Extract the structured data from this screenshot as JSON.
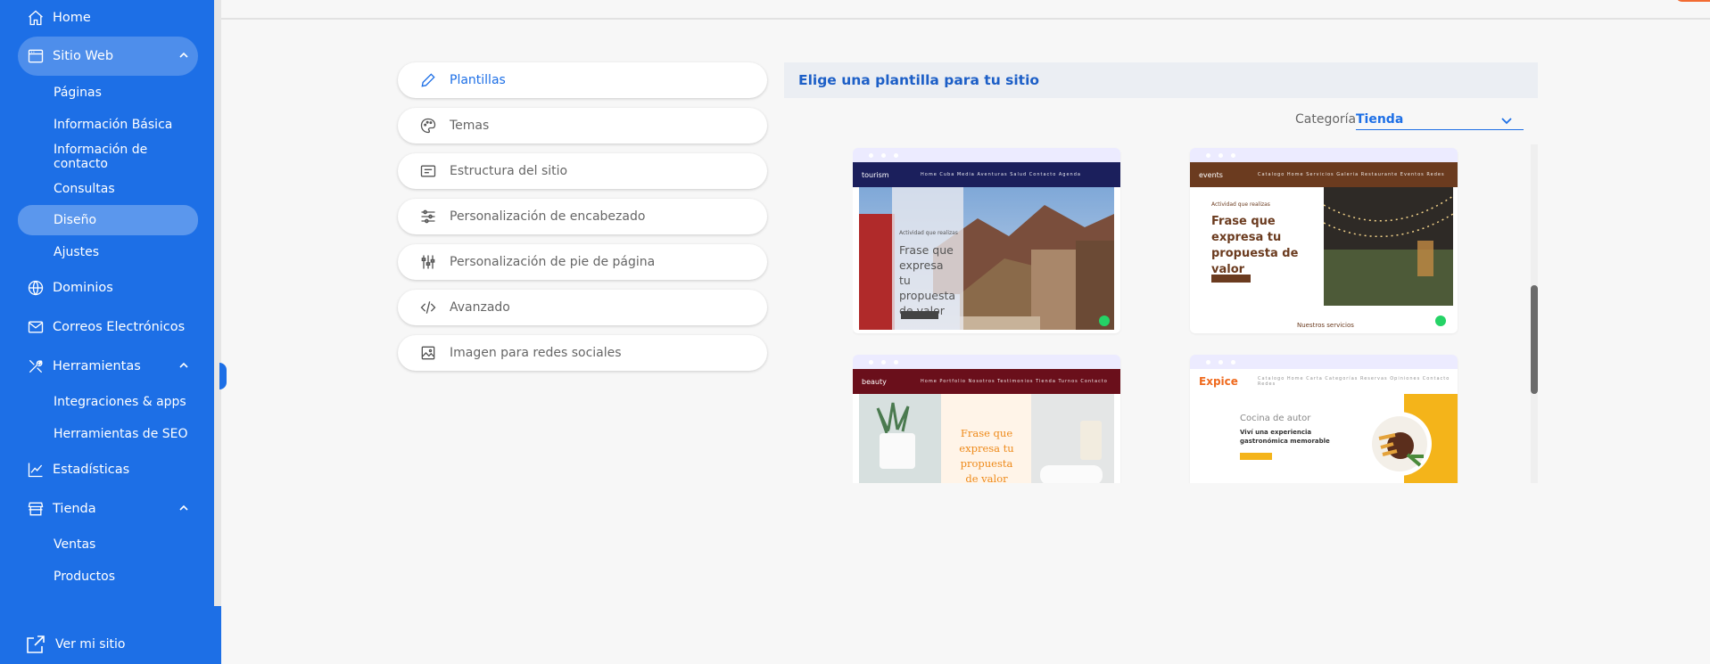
{
  "sidebar": {
    "items": [
      {
        "label": "Home",
        "icon": "home-icon"
      },
      {
        "label": "Sitio Web",
        "icon": "browser-window-icon"
      },
      {
        "label": "Dominios",
        "icon": "globe-icon"
      },
      {
        "label": "Correos Electrónicos",
        "icon": "envelope-icon"
      },
      {
        "label": "Herramientas",
        "icon": "tools-icon"
      },
      {
        "label": "Estadísticas",
        "icon": "line-chart-icon"
      },
      {
        "label": "Tienda",
        "icon": "store-icon"
      }
    ],
    "sitio_web_sub": [
      "Páginas",
      "Información Básica",
      "Información de contacto",
      "Consultas",
      "Diseño",
      "Ajustes"
    ],
    "herramientas_sub": [
      "Integraciones & apps",
      "Herramientas de SEO"
    ],
    "tienda_sub": [
      "Ventas",
      "Productos"
    ],
    "ver_mi_sitio": "Ver mi sitio",
    "color": "#1d6fe6"
  },
  "menu": [
    {
      "label": "Plantillas",
      "icon": "pencil-icon",
      "active": true
    },
    {
      "label": "Temas",
      "icon": "palette-icon"
    },
    {
      "label": "Estructura del sitio",
      "icon": "layout-icon"
    },
    {
      "label": "Personalización de encabezado",
      "icon": "sliders-icon"
    },
    {
      "label": "Personalización de pie de página",
      "icon": "vertical-sliders-icon"
    },
    {
      "label": "Avanzado",
      "icon": "code-icon"
    },
    {
      "label": "Imagen para redes sociales",
      "icon": "image-icon"
    }
  ],
  "panel": {
    "title": "Elige una plantilla para tu sitio",
    "category_label": "Categoría",
    "category_value": "Tienda"
  },
  "templates": [
    {
      "name": "tourism",
      "nav": "Home Cuba Media Aventuras Salud Contacto Agenda",
      "kicker": "Actividad que realizas",
      "headline": "Frase que expresa tu propuesta de valor",
      "color": "#1b1f5c"
    },
    {
      "name": "events",
      "nav": "Catalogo Home Servicios Galeria Restaurante Eventos Redes",
      "kicker": "Actividad que realizas",
      "headline": "Frase que expresa tu propuesta de valor",
      "footer": "Nuestros servicios",
      "color": "#6b3b1f"
    },
    {
      "name": "beauty",
      "nav": "Home Portfolio Nosotros Testimonios Tienda Turnos Contacto",
      "headline": "Frase que expresa tu propuesta de valor",
      "color": "#6a0f1b"
    },
    {
      "name": "Expice",
      "nav": "Catalogo Home Carta Categorías Reservas Opiniones Contacto Redes",
      "kicker": "Cocina de autor",
      "headline": "Viví una experiencia gastronómica memorable",
      "color": "#ef6a1e"
    }
  ]
}
